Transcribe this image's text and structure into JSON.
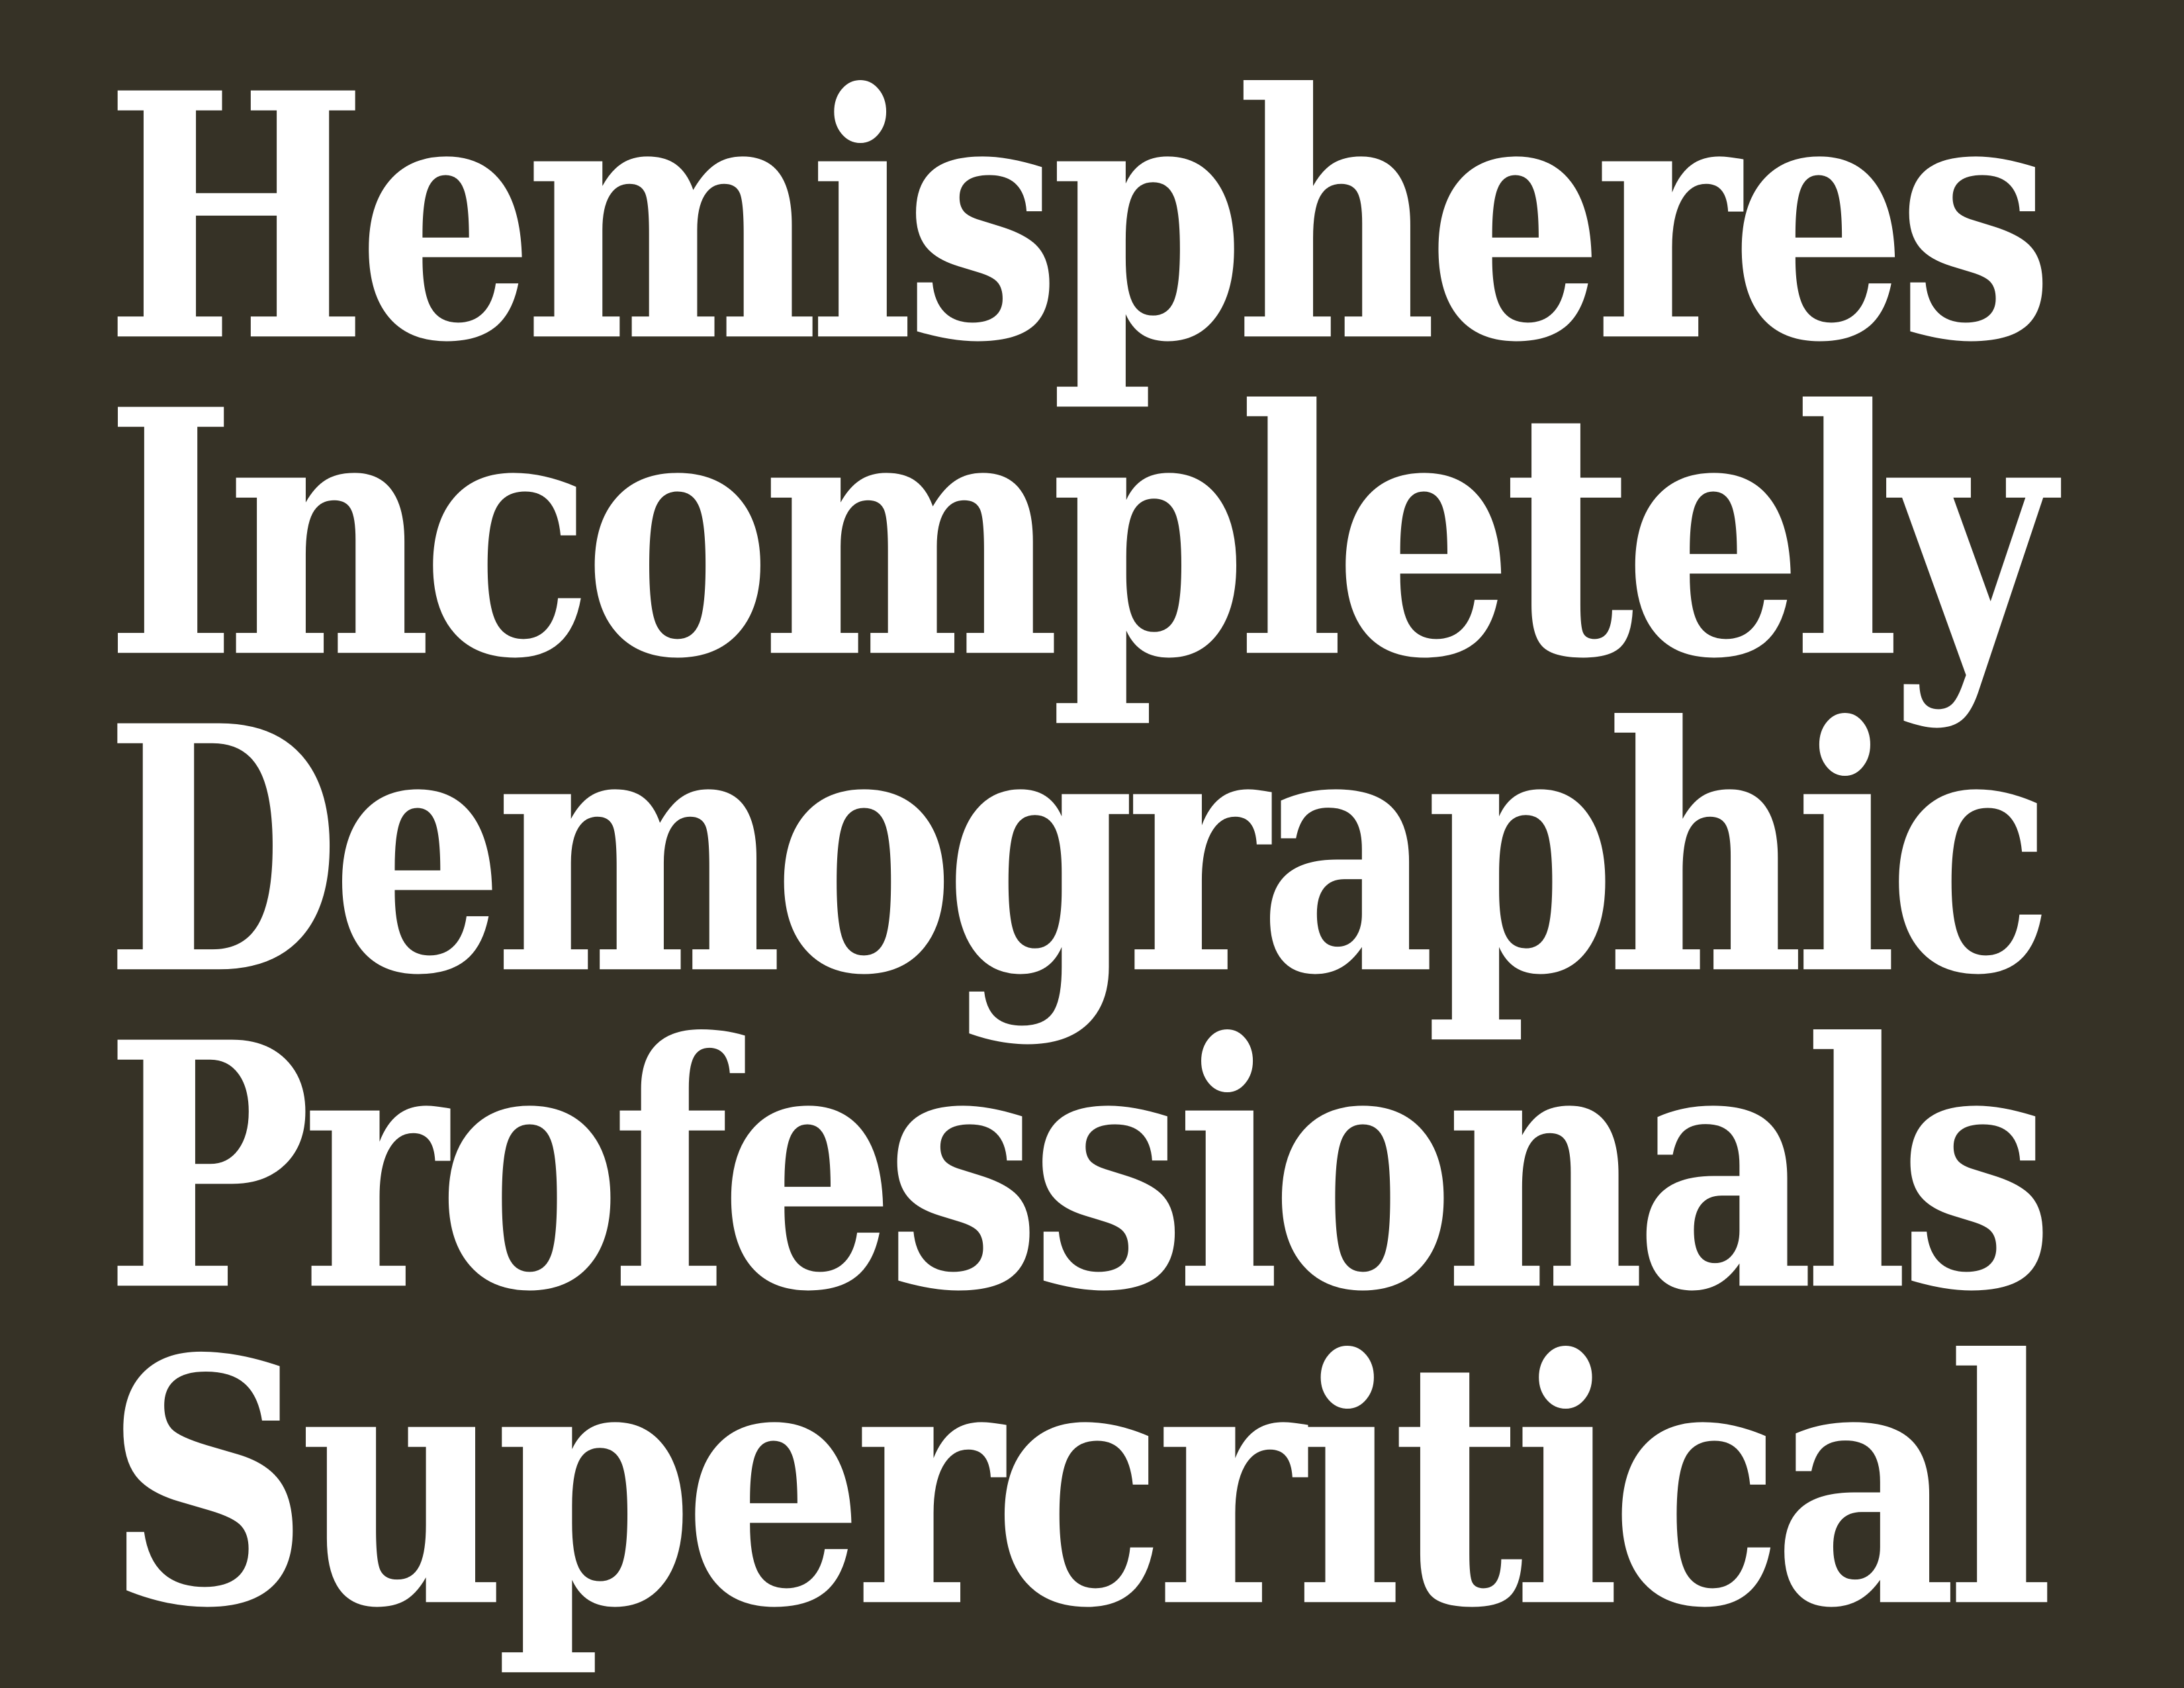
{
  "background_color": "#363226",
  "text_color": "#ffffff",
  "words": [
    "Hemispheres",
    "Incompletely",
    "Demographic",
    "Professionals",
    "Supercritical"
  ]
}
